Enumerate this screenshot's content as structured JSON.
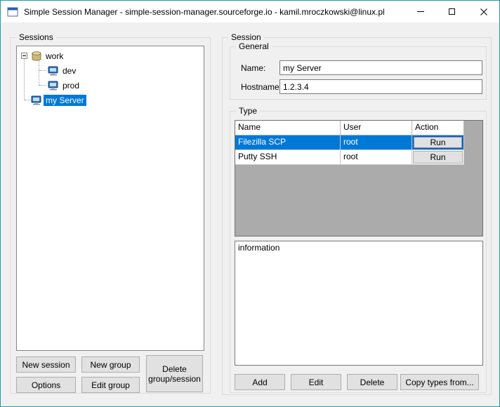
{
  "titlebar": {
    "title": "Simple Session Manager - simple-session-manager.sourceforge.io - kamil.mroczkowski@linux.pl"
  },
  "icons": {
    "app": "window-form-icon",
    "minimize": "minimize-line",
    "maximize": "maximize-square",
    "close": "close-x",
    "group_node": "cylinder-box-icon",
    "session_node": "blue-computer-icon",
    "expander": "minus-box"
  },
  "colors": {
    "window_border": "#1a9cb0",
    "client_bg": "#f0f0f0",
    "selection": "#0078d7",
    "grid_bg": "#ababab",
    "button_bg": "#e1e1e1"
  },
  "sessions": {
    "group_label": "Sessions",
    "tree": {
      "nodes": [
        {
          "label": "work",
          "type": "group",
          "expanded": true,
          "children": [
            {
              "label": "dev",
              "type": "session"
            },
            {
              "label": "prod",
              "type": "session"
            }
          ]
        },
        {
          "label": "my Server",
          "type": "session",
          "selected": true
        }
      ]
    },
    "buttons": {
      "new_session": "New session",
      "new_group": "New group",
      "delete_group_session": "Delete group/session",
      "options": "Options",
      "edit_group": "Edit group"
    }
  },
  "session": {
    "group_label": "Session",
    "general": {
      "group_label": "General",
      "name_label": "Name:",
      "name_value": "my Server",
      "hostname_label": "Hostname:",
      "hostname_value": "1.2.3.4"
    },
    "type": {
      "group_label": "Type",
      "grid": {
        "columns": [
          "Name",
          "User",
          "Action"
        ],
        "rows": [
          {
            "name": "Filezilla SCP",
            "user": "root",
            "action_label": "Run",
            "selected": true
          },
          {
            "name": "Putty SSH",
            "user": "root",
            "action_label": "Run",
            "selected": false
          }
        ]
      },
      "info_text": "information",
      "buttons": {
        "add": "Add",
        "edit": "Edit",
        "delete": "Delete",
        "copy_types_from": "Copy types from..."
      }
    }
  }
}
